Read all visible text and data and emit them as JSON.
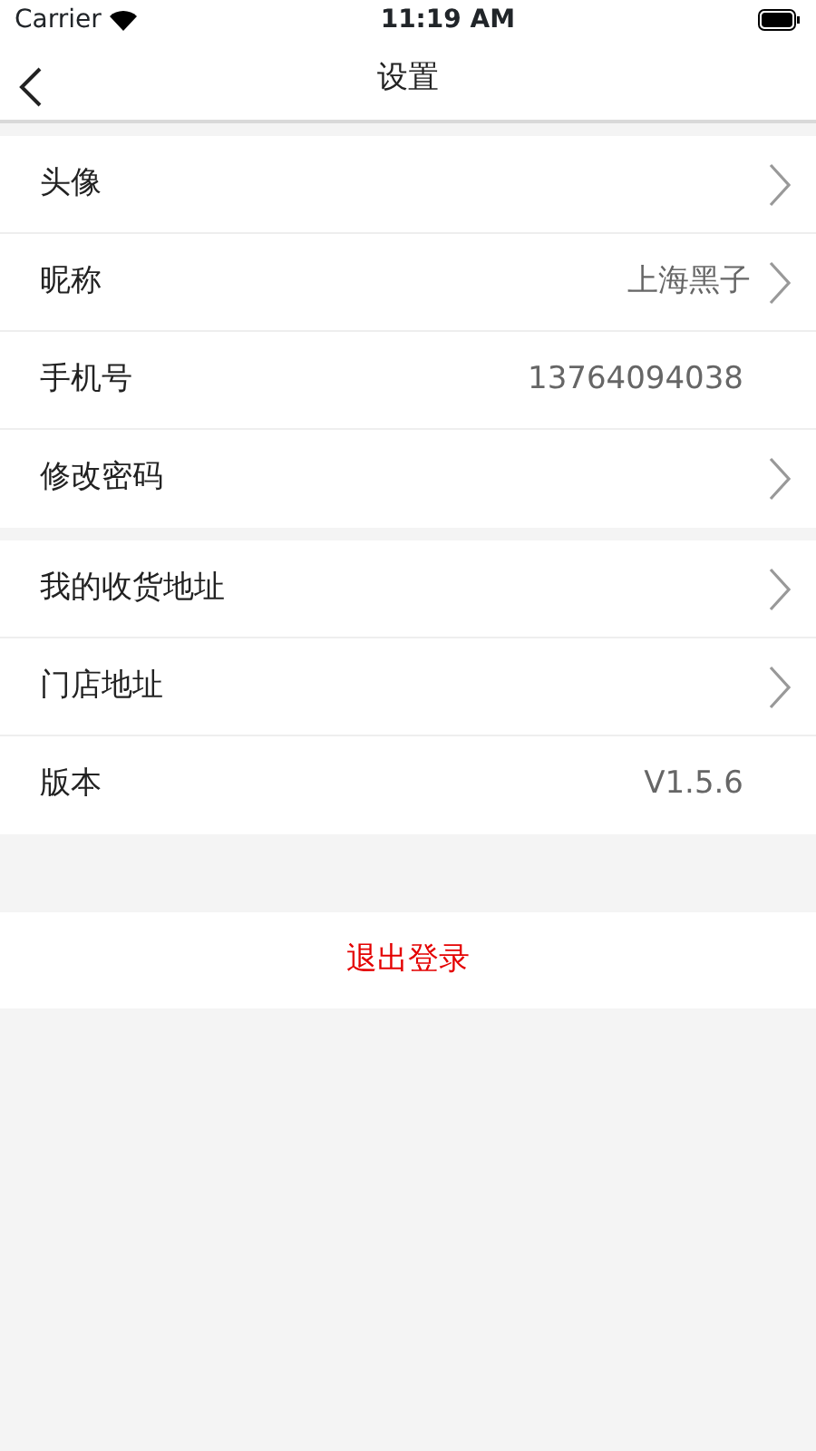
{
  "status_bar": {
    "carrier": "Carrier",
    "time": "11:19 AM"
  },
  "nav": {
    "title": "设置"
  },
  "groups": [
    {
      "rows": [
        {
          "label": "头像",
          "chevron": true
        },
        {
          "label": "昵称",
          "value": "上海黑子",
          "chevron": true
        },
        {
          "label": "手机号",
          "value": "13764094038",
          "chevron": false
        },
        {
          "label": "修改密码",
          "chevron": true
        }
      ]
    },
    {
      "rows": [
        {
          "label": "我的收货地址",
          "chevron": true
        },
        {
          "label": "门店地址",
          "chevron": true
        },
        {
          "label": "版本",
          "value": "V1.5.6",
          "chevron": false
        }
      ]
    }
  ],
  "logout": "退出登录"
}
